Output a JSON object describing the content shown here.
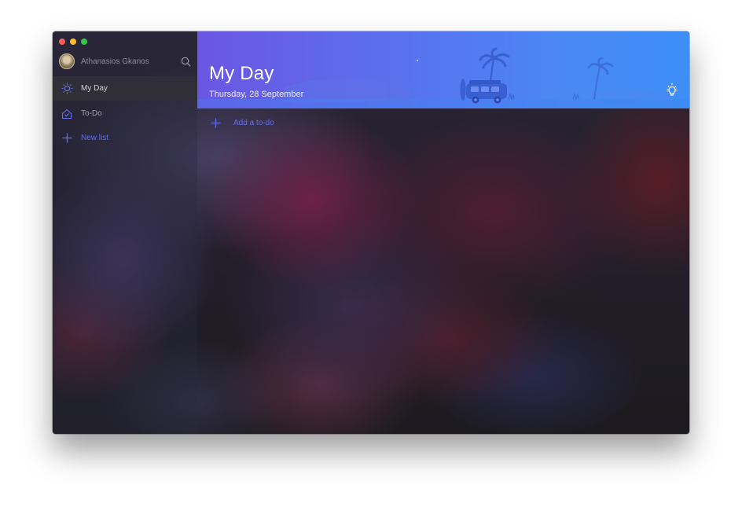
{
  "window": {
    "traffic_lights": {
      "close": "#fc5f57",
      "minimize": "#fdbc2e",
      "zoom": "#33c748"
    }
  },
  "sidebar": {
    "user_name": "Athanasios Gkanos",
    "search_icon": "search-icon",
    "items": [
      {
        "label": "My Day",
        "icon": "sun-icon",
        "active": true
      },
      {
        "label": "To-Do",
        "icon": "home-icon",
        "active": false
      },
      {
        "label": "New list",
        "icon": "plus-icon",
        "active": false
      }
    ]
  },
  "header": {
    "title": "My Day",
    "date": "Thursday, 28 September",
    "suggestions_icon": "lightbulb-icon"
  },
  "main": {
    "add_todo_label": "Add a to-do"
  },
  "colors": {
    "accent": "#5b6cf0",
    "header_gradient_start": "#6b56e2",
    "header_gradient_end": "#3d8ef6"
  }
}
